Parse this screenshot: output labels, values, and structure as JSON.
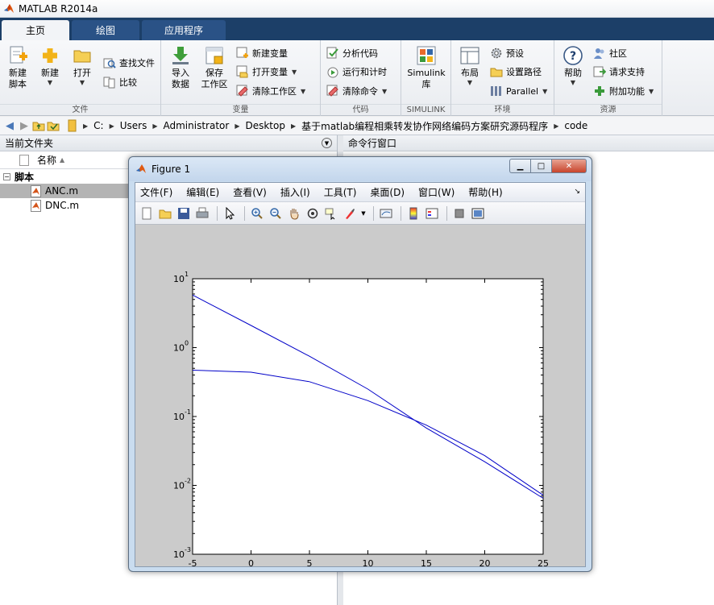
{
  "window": {
    "title": "MATLAB R2014a"
  },
  "ribbon": {
    "tabs": [
      "主页",
      "绘图",
      "应用程序"
    ],
    "groups": {
      "file": {
        "label": "文件",
        "new_script": "新建\n脚本",
        "new": "新建",
        "open": "打开",
        "find_files": "查找文件",
        "compare": "比较"
      },
      "variable": {
        "label": "变量",
        "import": "导入\n数据",
        "save_workspace": "保存\n工作区",
        "new_variable": "新建变量",
        "open_variable": "打开变量",
        "clear_workspace": "清除工作区"
      },
      "code": {
        "label": "代码",
        "analyze": "分析代码",
        "run_time": "运行和计时",
        "clear_commands": "清除命令"
      },
      "simulink": {
        "label": "SIMULINK",
        "library": "Simulink\n库"
      },
      "environment": {
        "label": "环境",
        "layout": "布局",
        "preferences": "预设",
        "set_path": "设置路径",
        "parallel": "Parallel"
      },
      "resources": {
        "label": "资源",
        "help": "帮助",
        "community": "社区",
        "request_support": "请求支持",
        "addons": "附加功能"
      }
    }
  },
  "address": {
    "crumbs": [
      "C:",
      "Users",
      "Administrator",
      "Desktop",
      "基于matlab编程相乘转发协作网络编码方案研究源码程序",
      "code"
    ]
  },
  "current_folder": {
    "title": "当前文件夹",
    "name_column": "名称",
    "folder": "脚本",
    "files": [
      "ANC.m",
      "DNC.m"
    ]
  },
  "command_window": {
    "title": "命令行窗口"
  },
  "figure": {
    "title": "Figure 1",
    "menu": [
      "文件(F)",
      "编辑(E)",
      "查看(V)",
      "插入(I)",
      "工具(T)",
      "桌面(D)",
      "窗口(W)",
      "帮助(H)"
    ]
  },
  "colors": {
    "ribbon_tab_bg": "#1c3f68",
    "plot_line": "#0000c8"
  },
  "chart_data": {
    "type": "line",
    "title": "",
    "xlabel": "",
    "ylabel": "",
    "xlim": [
      -5,
      25
    ],
    "ylim": [
      0.001,
      10
    ],
    "yscale": "log",
    "xticks": [
      -5,
      0,
      5,
      10,
      15,
      20,
      25
    ],
    "yticks": [
      {
        "value": 0.001,
        "base": "10",
        "exp": "-3"
      },
      {
        "value": 0.01,
        "base": "10",
        "exp": "-2"
      },
      {
        "value": 0.1,
        "base": "10",
        "exp": "-1"
      },
      {
        "value": 1,
        "base": "10",
        "exp": "0"
      },
      {
        "value": 10,
        "base": "10",
        "exp": "1"
      }
    ],
    "grid": false,
    "series": [
      {
        "x": [
          -5,
          0,
          5,
          10,
          15,
          20,
          25
        ],
        "y": [
          5.8,
          2.1,
          0.75,
          0.25,
          0.068,
          0.022,
          0.0065
        ]
      },
      {
        "x": [
          -5,
          0,
          5,
          10,
          15,
          20,
          25
        ],
        "y": [
          0.47,
          0.44,
          0.32,
          0.17,
          0.075,
          0.027,
          0.0072
        ]
      }
    ]
  }
}
